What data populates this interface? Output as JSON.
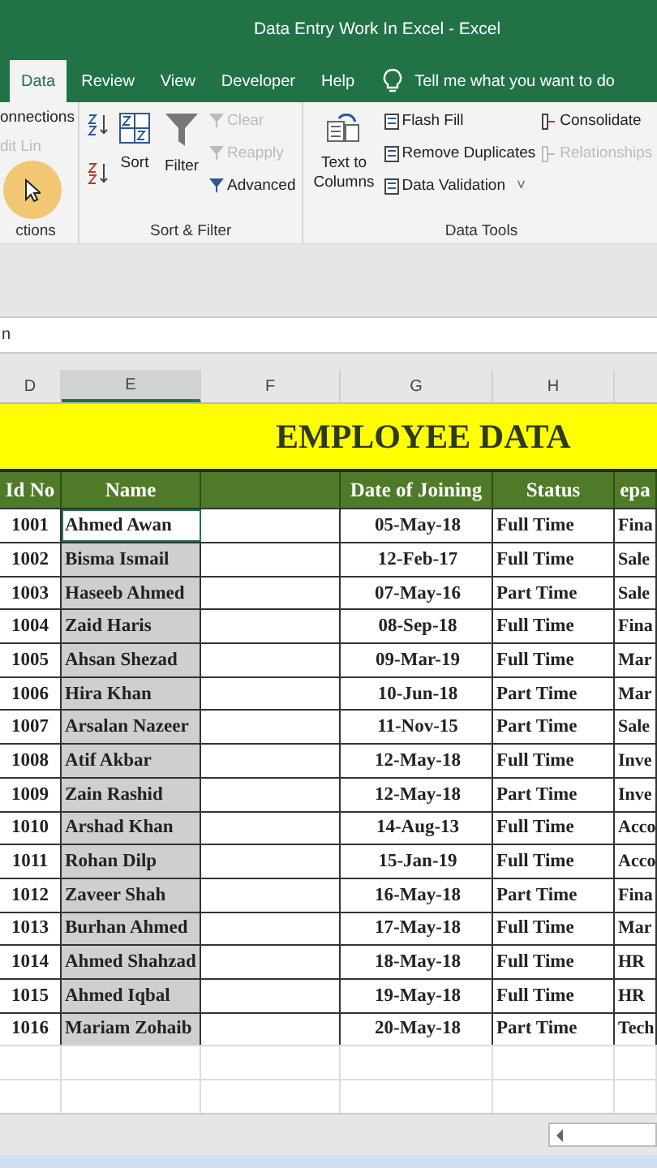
{
  "window": {
    "title": "Data Entry Work In Excel  -  Excel"
  },
  "tabs": [
    {
      "label": "Data",
      "selected": true
    },
    {
      "label": "Review",
      "selected": false
    },
    {
      "label": "View",
      "selected": false
    },
    {
      "label": "Developer",
      "selected": false
    },
    {
      "label": "Help",
      "selected": false
    }
  ],
  "tell_me": {
    "placeholder": "Tell me what you want to do"
  },
  "ribbon": {
    "connections": {
      "items": [
        {
          "label": "onnections",
          "disabled": false
        },
        {
          "label": "dit Lin",
          "disabled": true
        }
      ],
      "group_label": "ctions"
    },
    "sort_filter": {
      "sort": "Sort",
      "filter": "Filter",
      "small": [
        {
          "label": "Clear",
          "disabled": true
        },
        {
          "label": "Reapply",
          "disabled": true
        },
        {
          "label": "Advanced",
          "disabled": false
        }
      ],
      "group_label": "Sort & Filter"
    },
    "data_tools": {
      "text_to_columns": "Text to\nColumns",
      "items": [
        {
          "label": "Flash Fill",
          "disabled": false
        },
        {
          "label": "Remove Duplicates",
          "disabled": false
        },
        {
          "label": "Data Validation",
          "disabled": false,
          "dropdown": "˅"
        }
      ],
      "side": [
        {
          "label": "Consolidate",
          "disabled": false
        },
        {
          "label": "Relationships",
          "disabled": true
        }
      ],
      "group_label": "Data Tools"
    }
  },
  "formula_bar": {
    "value": "n"
  },
  "columns": [
    {
      "label": "D",
      "selected": false
    },
    {
      "label": "E",
      "selected": true
    },
    {
      "label": "F",
      "selected": false
    },
    {
      "label": "G",
      "selected": false
    },
    {
      "label": "H",
      "selected": false
    }
  ],
  "sheet": {
    "title": "EMPLOYEE DATA",
    "headers": [
      "Id No",
      "Name",
      "Date of Joining",
      "Status",
      "epa"
    ],
    "rows": [
      {
        "id": "1001",
        "name": "Ahmed Awan",
        "date": "05-May-18",
        "status": "Full Time",
        "dept": "Fina",
        "active": true
      },
      {
        "id": "1002",
        "name": "Bisma Ismail",
        "date": "12-Feb-17",
        "status": "Full Time",
        "dept": "Sale",
        "active": false
      },
      {
        "id": "1003",
        "name": "Haseeb Ahmed",
        "date": "07-May-16",
        "status": "Part Time",
        "dept": "Sale",
        "active": false
      },
      {
        "id": "1004",
        "name": "Zaid Haris",
        "date": "08-Sep-18",
        "status": "Full Time",
        "dept": "Fina",
        "active": false
      },
      {
        "id": "1005",
        "name": "Ahsan Shezad",
        "date": "09-Mar-19",
        "status": "Full Time",
        "dept": "Mar",
        "active": false
      },
      {
        "id": "1006",
        "name": "Hira Khan",
        "date": "10-Jun-18",
        "status": "Part Time",
        "dept": "Mar",
        "active": false
      },
      {
        "id": "1007",
        "name": "Arsalan Nazeer",
        "date": "11-Nov-15",
        "status": "Part Time",
        "dept": "Sale",
        "active": false
      },
      {
        "id": "1008",
        "name": "Atif Akbar",
        "date": "12-May-18",
        "status": "Full Time",
        "dept": "Inve",
        "active": false
      },
      {
        "id": "1009",
        "name": "Zain Rashid",
        "date": "12-May-18",
        "status": "Part Time",
        "dept": "Inve",
        "active": false
      },
      {
        "id": "1010",
        "name": "Arshad Khan",
        "date": "14-Aug-13",
        "status": "Full Time",
        "dept": "Acco",
        "active": false
      },
      {
        "id": "1011",
        "name": "Rohan Dilp",
        "date": "15-Jan-19",
        "status": "Full Time",
        "dept": "Acco",
        "active": false
      },
      {
        "id": "1012",
        "name": "Zaveer Shah",
        "date": "16-May-18",
        "status": "Part Time",
        "dept": "Fina",
        "active": false
      },
      {
        "id": "1013",
        "name": "Burhan Ahmed",
        "date": "17-May-18",
        "status": "Full Time",
        "dept": "Mar",
        "active": false
      },
      {
        "id": "1014",
        "name": "Ahmed Shahzad",
        "date": "18-May-18",
        "status": "Full Time",
        "dept": "HR",
        "active": false
      },
      {
        "id": "1015",
        "name": "Ahmed Iqbal",
        "date": "19-May-18",
        "status": "Full Time",
        "dept": "HR",
        "active": false
      },
      {
        "id": "1016",
        "name": "Mariam Zohaib",
        "date": "20-May-18",
        "status": "Part Time",
        "dept": "Tech",
        "active": false
      }
    ]
  }
}
